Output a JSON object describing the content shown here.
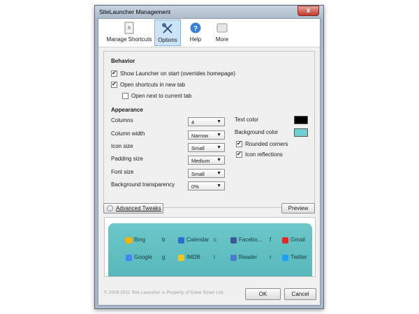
{
  "window": {
    "title": "SiteLauncher Management",
    "close_glyph": "x"
  },
  "toolbar": {
    "tabs": [
      {
        "label": "Manage Shortcuts",
        "icon": "shortcut-doc-icon"
      },
      {
        "label": "Options",
        "icon": "tools-icon",
        "active": true
      },
      {
        "label": "Help",
        "icon": "help-icon"
      },
      {
        "label": "More",
        "icon": "more-icon"
      }
    ]
  },
  "behavior": {
    "heading": "Behavior",
    "options": [
      {
        "label": "Show Launcher on start (overrides homepage)",
        "checked": true
      },
      {
        "label": "Open shortcuts in new tab",
        "checked": true
      },
      {
        "label": "Open next to current tab",
        "checked": false
      }
    ]
  },
  "appearance": {
    "heading": "Appearance",
    "settings": [
      {
        "label": "Columns",
        "value": "4"
      },
      {
        "label": "Column width",
        "value": "Narrow"
      },
      {
        "label": "Icon size",
        "value": "Small"
      },
      {
        "label": "Padding size",
        "value": "Medium"
      },
      {
        "label": "Font size",
        "value": "Small"
      },
      {
        "label": "Background transparency",
        "value": "0%"
      }
    ],
    "text_color": {
      "label": "Text color",
      "value": "#000000"
    },
    "background_color": {
      "label": "Background color",
      "value": "#6fd0d2"
    },
    "rounded_corners": {
      "label": "Rounded corners",
      "checked": true
    },
    "icon_reflections": {
      "label": "Icon reflections",
      "checked": true
    }
  },
  "actions": {
    "advanced_tweaks": "Advanced Tweaks",
    "preview": "Preview"
  },
  "preview_tiles": [
    {
      "name": "Bing",
      "key": "b",
      "icon_color": "#f4b400",
      "icon": "bing-icon"
    },
    {
      "name": "Calendar",
      "key": "c",
      "icon_color": "#2a6bd1",
      "icon": "calendar-icon"
    },
    {
      "name": "Facebo...",
      "key": "f",
      "icon_color": "#3b5998",
      "icon": "facebook-icon"
    },
    {
      "name": "Gmail",
      "key": "",
      "icon_color": "#d93025",
      "icon": "gmail-icon"
    },
    {
      "name": "Google",
      "key": "g",
      "icon_color": "#4285f4",
      "icon": "google-icon"
    },
    {
      "name": "IMDB",
      "key": "i",
      "icon_color": "#f5c518",
      "icon": "imdb-icon"
    },
    {
      "name": "Reader",
      "key": "r",
      "icon_color": "#4a7bd0",
      "icon": "reader-icon"
    },
    {
      "name": "Twitter",
      "key": "",
      "icon_color": "#1da1f2",
      "icon": "twitter-icon"
    }
  ],
  "footer": {
    "copyright": "© 2008-2011 Site Launcher is Property of Done Smart Ltd.",
    "ok": "OK",
    "cancel": "Cancel"
  }
}
